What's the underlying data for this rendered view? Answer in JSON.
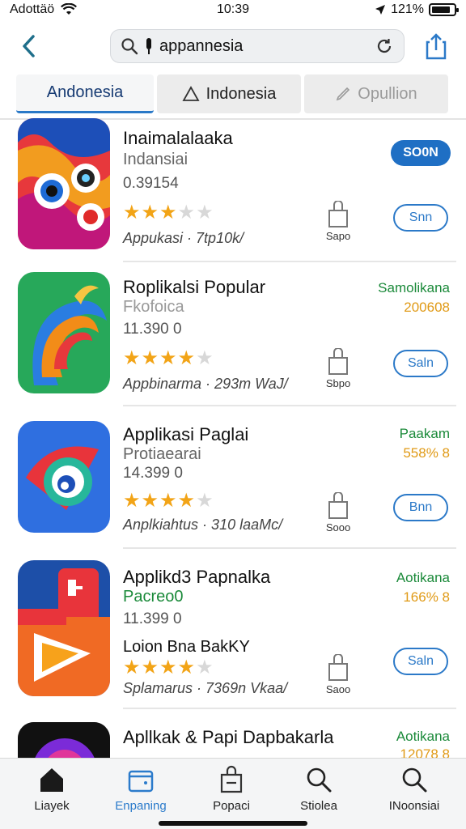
{
  "status": {
    "carrier": "Adottäö",
    "time": "10:39",
    "battery": "121%"
  },
  "search": {
    "query": "appannesia"
  },
  "tabs": [
    {
      "label": "Andonesia"
    },
    {
      "label": "Indonesia"
    },
    {
      "label": "Opullion"
    }
  ],
  "apps": [
    {
      "title": "Inaimalalaaka",
      "subtitle": "Indansiai",
      "count": "0.39154",
      "rating": 3,
      "meta": "Appukasi · 7tp10k/",
      "bag_label": "Sapo",
      "button_solid": "SO0N",
      "button_outline": "Snn",
      "badge_green": "",
      "badge_orange": ""
    },
    {
      "title": "Roplikalsi Popular",
      "subtitle": "Fkofoica",
      "count": "11.390 0",
      "rating": 4,
      "meta": "Appbinarma · 293m WaJ/",
      "bag_label": "Sbpo",
      "badge_green": "Samolikana",
      "badge_orange": "200608",
      "button_outline": "Saln"
    },
    {
      "title": "Applikasi Paglai",
      "subtitle": "Protiaearai",
      "count": "14.399 0",
      "rating": 4,
      "meta": "Anplkiahtus · 310 laaMc/",
      "bag_label": "Sooo",
      "badge_green": "Paakam",
      "badge_orange": "558% 8",
      "button_outline": "Bnn"
    },
    {
      "title": "Applikd3 Papnalka",
      "subtitle": "Pacreo0",
      "count": "11.399 0",
      "extra": "Loion Bna BakKY",
      "rating": 4,
      "meta": "Splamarus · 7369n Vkaa/",
      "bag_label": "Saoo",
      "badge_green": "Aotikana",
      "badge_orange": "166% 8",
      "button_outline": "Saln"
    },
    {
      "title": "Apllkak & Papi Dapbakarla",
      "badge_green": "Aotikana",
      "badge_orange": "12078 8"
    }
  ],
  "bottom_tabs": [
    {
      "label": "Liayek",
      "icon": "home-icon"
    },
    {
      "label": "Enpaning",
      "icon": "apps-icon"
    },
    {
      "label": "Popaci",
      "icon": "bag-icon"
    },
    {
      "label": "Stiolea",
      "icon": "search-icon"
    },
    {
      "label": "INoonsiai",
      "icon": "search-icon"
    }
  ],
  "colors": {
    "accent": "#2b79c8",
    "green": "#1b8a3a",
    "orange": "#e09a16",
    "star": "#f2a417"
  }
}
